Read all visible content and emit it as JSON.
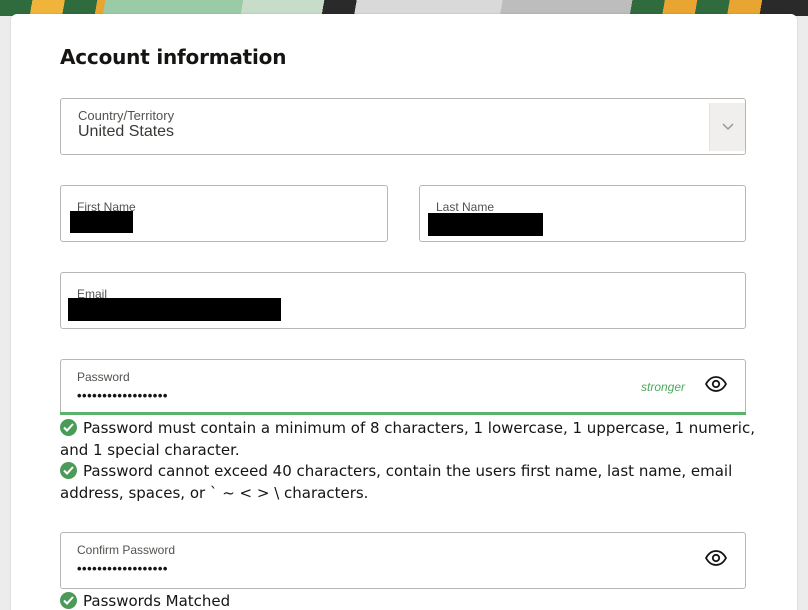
{
  "page": {
    "title": "Account information"
  },
  "country": {
    "label": "Country/Territory",
    "value": "United States"
  },
  "first_name": {
    "label": "First Name"
  },
  "last_name": {
    "label": "Last Name"
  },
  "email": {
    "label": "Email"
  },
  "password": {
    "label": "Password",
    "masked_value": "••••••••••••••••••",
    "strength": "stronger"
  },
  "rules": [
    {
      "text": "Password must contain a minimum of 8 characters, 1 lowercase, 1 uppercase, 1 numeric, and 1 special character."
    },
    {
      "text": "Password cannot exceed 40 characters, contain the users first name, last name, email address, spaces, or ` ~ < > \\ characters."
    }
  ],
  "confirm_password": {
    "label": "Confirm Password",
    "masked_value": "••••••••••••••••••",
    "match_message": "Passwords Matched"
  },
  "colors": {
    "success_green": "#4a9b58",
    "strength_green": "#4fa75e",
    "border": "#b8b6b3",
    "text": "#161513"
  },
  "icons": {
    "country_select": "chevron-down-icon",
    "password_toggle": "eye-icon",
    "rule_status": "check-circle-icon"
  }
}
